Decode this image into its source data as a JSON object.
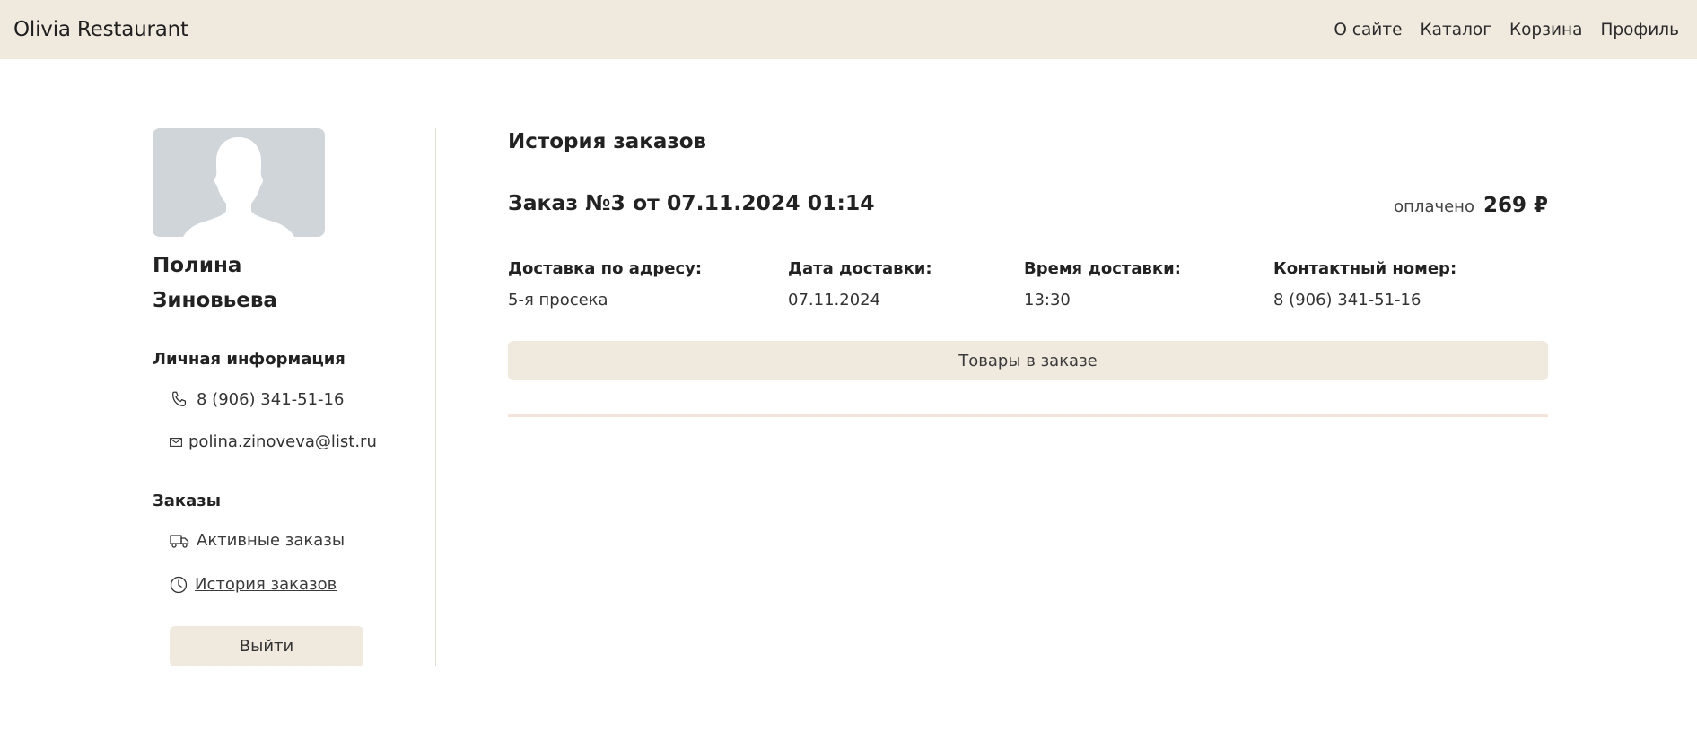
{
  "navbar": {
    "brand": "Olivia Restaurant",
    "links": [
      "О сайте",
      "Каталог",
      "Корзина",
      "Профиль"
    ]
  },
  "profile": {
    "first_name": "Полина",
    "last_name": "Зиновьева",
    "personal_info_label": "Личная информация",
    "phone": "8 (906) 341-51-16",
    "email": "polina.zinoveva@list.ru",
    "orders_label": "Заказы",
    "active_orders": "Активные заказы",
    "order_history": "История заказов",
    "logout": "Выйти"
  },
  "main": {
    "heading": "История заказов",
    "order": {
      "title": "Заказ №3 от 07.11.2024 01:14",
      "status": "оплачено",
      "amount": "269 ₽",
      "details": [
        {
          "label": "Доставка по адресу:",
          "value": "5-я просека"
        },
        {
          "label": "Дата доставки:",
          "value": "07.11.2024"
        },
        {
          "label": "Время доставки:",
          "value": "13:30"
        },
        {
          "label": "Контактный номер:",
          "value": "8 (906) 341-51-16"
        }
      ],
      "items_button": "Товары в заказе"
    }
  },
  "colors": {
    "navbar_bg": "#f0e9de",
    "button_bg": "#f0e9de",
    "avatar_bg": "#d0d5da"
  }
}
